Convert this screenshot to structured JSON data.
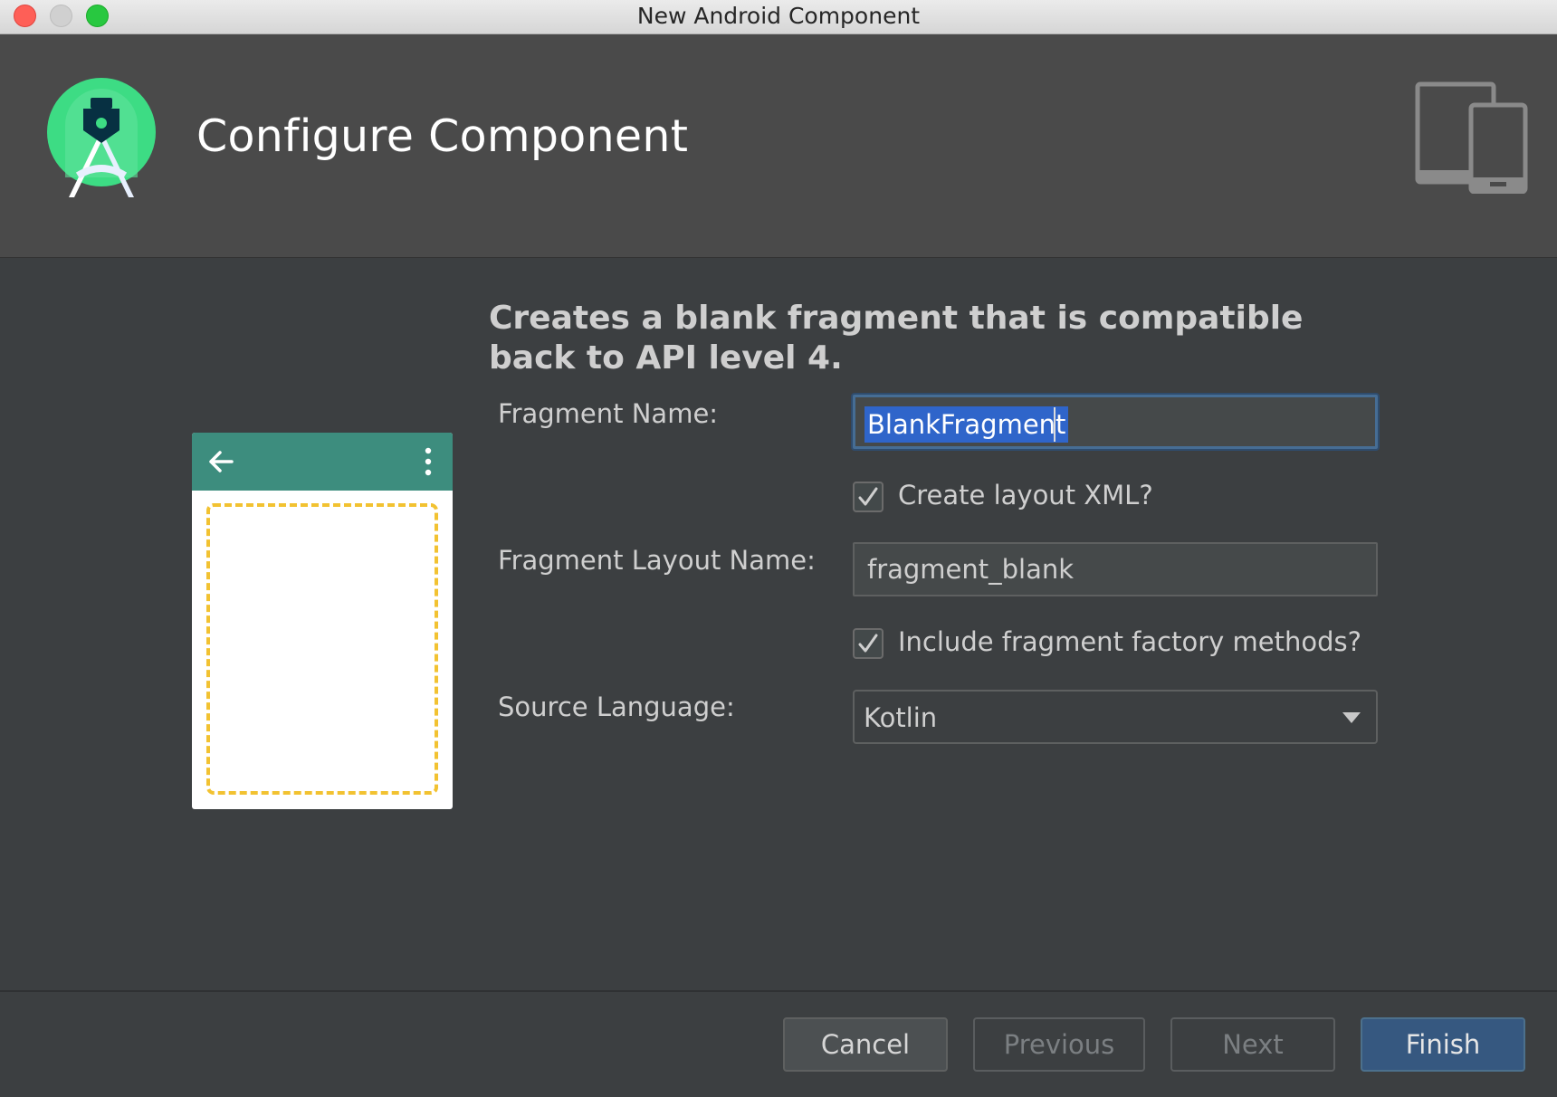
{
  "window": {
    "title": "New Android Component"
  },
  "header": {
    "title": "Configure Component",
    "logo_icon": "android-studio-logo-icon",
    "device_icon": "phone-tablet-devices-icon"
  },
  "description": "Creates a blank fragment that is compatible back to API level 4.",
  "form": {
    "fragment_name": {
      "label": "Fragment Name:",
      "value": "BlankFragment"
    },
    "create_layout": {
      "label": "Create layout XML?",
      "checked": true
    },
    "layout_name": {
      "label": "Fragment Layout Name:",
      "value": "fragment_blank"
    },
    "factory_methods": {
      "label": "Include fragment factory methods?",
      "checked": true
    },
    "source_language": {
      "label": "Source Language:",
      "value": "Kotlin"
    }
  },
  "buttons": {
    "cancel": "Cancel",
    "previous": "Previous",
    "next": "Next",
    "finish": "Finish"
  },
  "colors": {
    "preview_toolbar": "#3d8d7e",
    "preview_frame": "#f2c231",
    "finish_button": "#365880",
    "selection": "#2f65ca"
  }
}
